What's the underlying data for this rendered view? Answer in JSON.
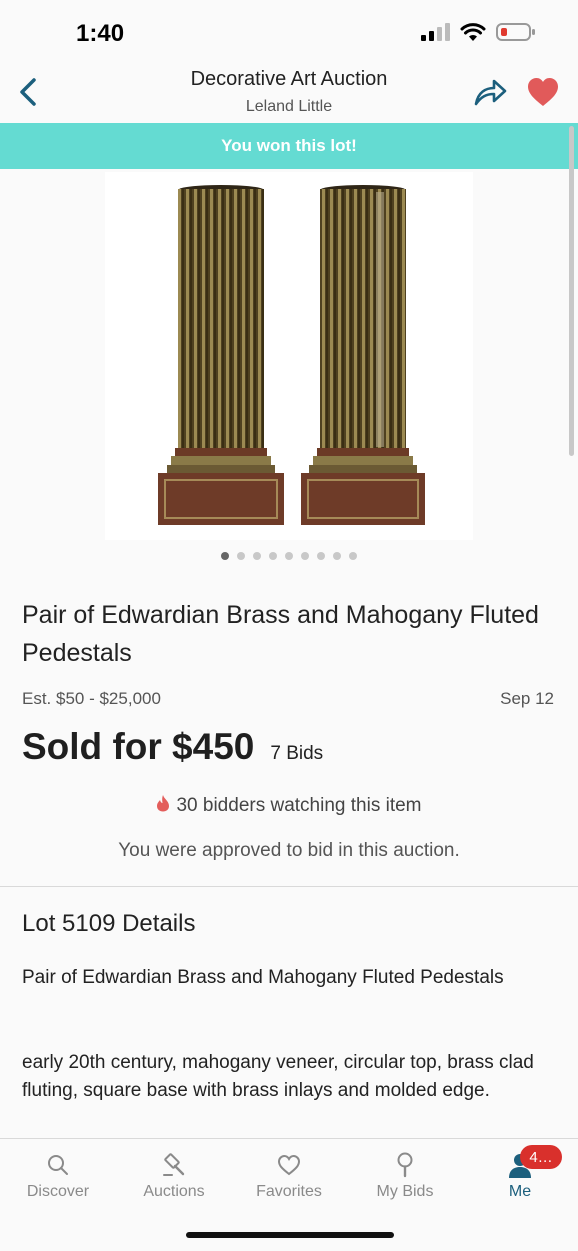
{
  "status_bar": {
    "time": "1:40"
  },
  "nav": {
    "title": "Decorative Art Auction",
    "subtitle": "Leland Little"
  },
  "banner": {
    "text": "You won this lot!"
  },
  "gallery": {
    "dot_count": 9,
    "active_index": 0,
    "image_description": "pair of fluted brass and mahogany pedestals"
  },
  "lot": {
    "title": "Pair of Edwardian Brass and Mahogany Fluted Pedestals",
    "estimate": "Est. $50 - $25,000",
    "date": "Sep 12",
    "sold_text": "Sold for $450",
    "bids_text": "7 Bids",
    "watchers_text": "30 bidders watching this item",
    "approved_text": "You were approved to bid in this auction."
  },
  "details": {
    "heading": "Lot 5109 Details",
    "desc_title": "Pair of Edwardian Brass and Mahogany Fluted Pedestals",
    "desc_body": "early 20th century, mahogany veneer, circular top, brass clad fluting, square base with brass inlays and molded edge."
  },
  "tabs": [
    {
      "label": "Discover",
      "icon": "search-icon"
    },
    {
      "label": "Auctions",
      "icon": "gavel-icon"
    },
    {
      "label": "Favorites",
      "icon": "heart-outline-icon"
    },
    {
      "label": "My Bids",
      "icon": "paddle-icon"
    },
    {
      "label": "Me",
      "icon": "person-icon",
      "badge": "4…",
      "active": true
    }
  ],
  "colors": {
    "accent": "#1c5f7d",
    "banner": "#64dbd2",
    "heart": "#e15a5a",
    "badge": "#d9302c"
  }
}
